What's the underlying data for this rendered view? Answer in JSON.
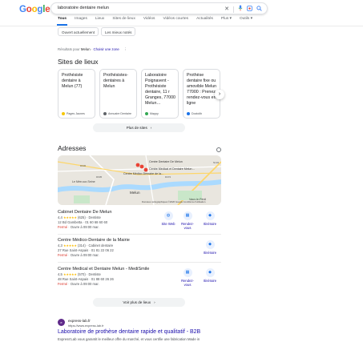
{
  "header": {
    "logo": "Google",
    "logo_colors": [
      "#4285F4",
      "#EA4335",
      "#FBBC05",
      "#4285F4",
      "#34A853",
      "#EA4335"
    ],
    "search_value": "laboratoire dentaire melun",
    "icons": [
      "close-icon",
      "mic-icon",
      "lens-icon",
      "search-icon"
    ]
  },
  "tabs": [
    {
      "label": "Tous",
      "active": true
    },
    {
      "label": "Images"
    },
    {
      "label": "Lieux"
    },
    {
      "label": "Sites de lieux"
    },
    {
      "label": "Vidéos"
    },
    {
      "label": "Vidéos courtes"
    },
    {
      "label": "Actualités"
    },
    {
      "label": "Plus ▾"
    },
    {
      "label": "Outils ▾"
    }
  ],
  "filters": [
    "Ouvert actuellement",
    "Les mieux notés"
  ],
  "results_for": {
    "prefix": "Résultats pour",
    "place": "Melun",
    "change": "Choisir une zone"
  },
  "sites_section": {
    "title": "Sites de lieux",
    "cards": [
      {
        "title": "Prothésiste dentaire à Melun (77)",
        "source": "Pages Jaunes",
        "fav_color": "#f6c600"
      },
      {
        "title": "Prothésistes-dentaires à Melun",
        "source": "Annuaire Dentaire",
        "fav_color": "#5f6368"
      },
      {
        "title": "Laboratoire Poignavent - Prothésiste dentaire, 11 r Granges, 77000 Melun…",
        "source": "Mappy",
        "fav_color": "#34a853"
      },
      {
        "title": "Prothèse dentaire fixe ou amovible Melun 77000 : Prenez rendez-vous en ligne",
        "source": "Doctolib",
        "fav_color": "#1a73e8"
      }
    ],
    "more": "Plus de sites"
  },
  "addresses_section": {
    "title": "Adresses",
    "map": {
      "labels": [
        "Centre Dentaire De Melun",
        "Centre Médico-Dentaire de la…",
        "Centre Medical et Dentaire Melun…",
        "Le Mée-sur-Seine",
        "Melun",
        "Vaux-le-Pénil"
      ],
      "road_labels": [
        "D636",
        "D605",
        "D372",
        "N104"
      ],
      "attribution": "Données cartographiques ©2026 Google   Conditions d'utilisation"
    },
    "places": [
      {
        "name": "Cabinet Dentaire De Melun",
        "rating": "4,4",
        "stars": "★★★★★",
        "reviews": "(625)",
        "category": "Dentiste",
        "address": "12 Bd Gambetta · 01 60 68 60 60",
        "status": "Fermé",
        "hours": "· Ouvre à 09:00 mar.",
        "actions": [
          {
            "label": "Site Web",
            "icon": "globe-icon"
          },
          {
            "label": "Rendez-vous",
            "icon": "calendar-icon"
          },
          {
            "label": "Itinéraire",
            "icon": "directions-icon"
          }
        ]
      },
      {
        "name": "Centre Médico-Dentaire de la Mairie",
        "rating": "4,3",
        "stars": "★★★★★",
        "reviews": "(314)",
        "category": "Cabinet dentaire",
        "address": "27 Rue Saint-Aspais · 01 81 22 06 22",
        "status": "Fermé",
        "hours": "· Ouvre à 09:00 mar.",
        "actions": [
          {
            "label": "Itinéraire",
            "icon": "directions-icon"
          }
        ]
      },
      {
        "name": "Centre Medical et Dentaire Melun - MediSmile",
        "rating": "4,5",
        "stars": "★★★★★",
        "reviews": "(570)",
        "category": "Dentiste",
        "address": "48 Rue Saint-Aspais · 01 88 60 26 26",
        "status": "Fermé",
        "hours": "· Ouvre à 09:00 mar.",
        "actions": [
          {
            "label": "Rendez-vous",
            "icon": "calendar-icon"
          },
          {
            "label": "Itinéraire",
            "icon": "directions-icon"
          }
        ]
      }
    ],
    "more": "Voir plus de lieux"
  },
  "organic": {
    "favicon_text": "e",
    "site_name": "express-lab.fr",
    "url": "https://www.express-lab.fr",
    "title": "Laboratoire de prothèse dentaire rapide et qualitatif - B2B",
    "snippet": "Express'Lab vous garantit le meilleur offre du marché, et vous certifie une fabrication Made in"
  }
}
